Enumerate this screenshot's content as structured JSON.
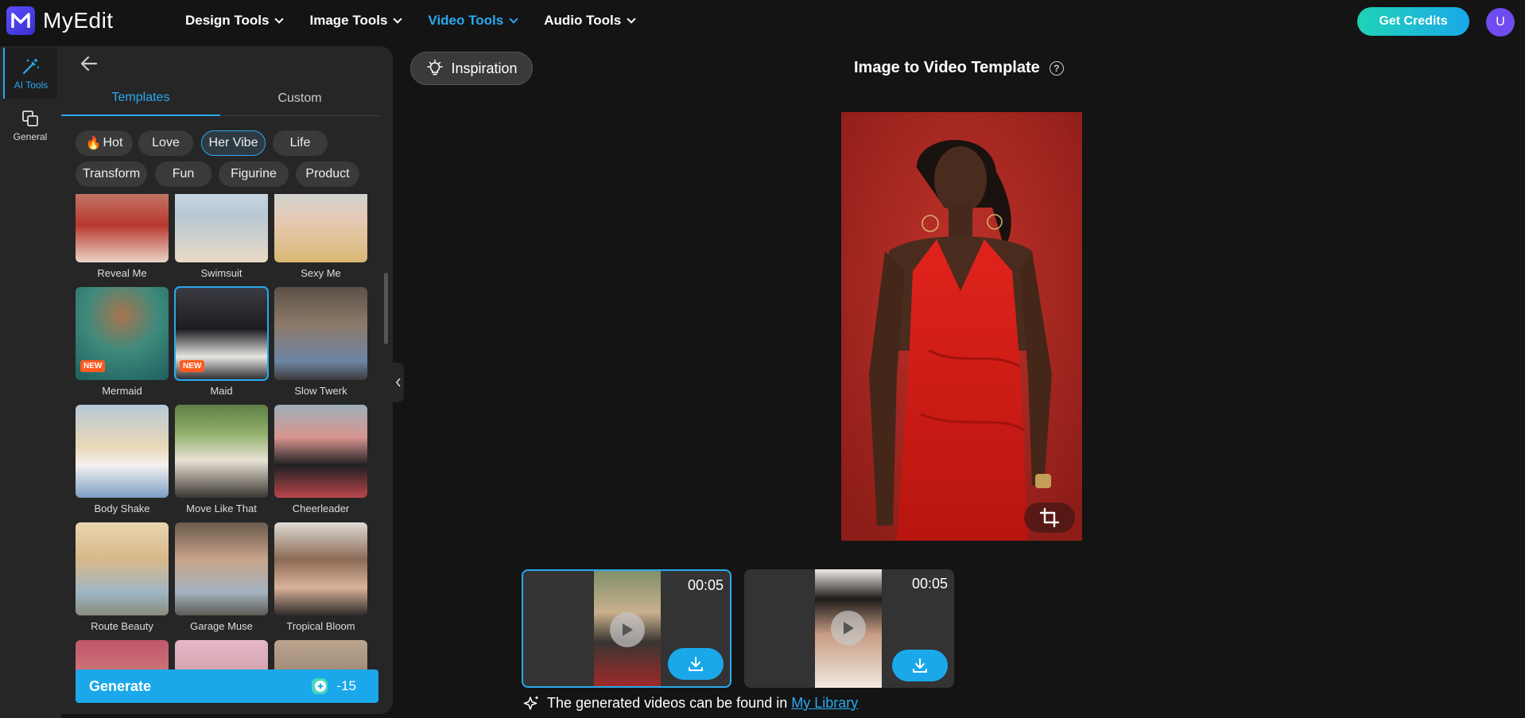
{
  "app": {
    "name": "MyEdit"
  },
  "nav": [
    {
      "label": "Design Tools",
      "active": false
    },
    {
      "label": "Image Tools",
      "active": false
    },
    {
      "label": "Video Tools",
      "active": true
    },
    {
      "label": "Audio Tools",
      "active": false
    }
  ],
  "header": {
    "credits_label": "Get Credits",
    "avatar_initial": "U"
  },
  "rail": {
    "ai_tools": "AI Tools",
    "general": "General"
  },
  "panel": {
    "tabs": [
      "Templates",
      "Custom"
    ],
    "active_tab": "Templates",
    "chips": [
      "Hot",
      "Love",
      "Her Vibe",
      "Life",
      "Transform",
      "Fun",
      "Figurine",
      "Product"
    ],
    "active_chip": "Her Vibe",
    "templates": [
      {
        "label": "Reveal Me",
        "new": false
      },
      {
        "label": "Swimsuit",
        "new": false
      },
      {
        "label": "Sexy Me",
        "new": false
      },
      {
        "label": "Mermaid",
        "new": true
      },
      {
        "label": "Maid",
        "new": true,
        "selected": true
      },
      {
        "label": "Slow Twerk",
        "new": false
      },
      {
        "label": "Body Shake",
        "new": false
      },
      {
        "label": "Move Like That",
        "new": false
      },
      {
        "label": "Cheerleader",
        "new": false
      },
      {
        "label": "Route Beauty",
        "new": false
      },
      {
        "label": "Garage Muse",
        "new": false
      },
      {
        "label": "Tropical Bloom",
        "new": false
      }
    ],
    "new_badge": "NEW",
    "generate_label": "Generate",
    "generate_cost": "-15"
  },
  "main": {
    "inspiration_label": "Inspiration",
    "title": "Image to Video Template",
    "help_glyph": "?",
    "results": [
      {
        "duration": "00:05",
        "selected": true
      },
      {
        "duration": "00:05",
        "selected": false
      }
    ],
    "note_text": "The generated videos can be found in",
    "note_link": "My Library"
  },
  "colors": {
    "accent": "#29a9f0",
    "bg": "#141414",
    "panel": "#262626",
    "new_badge": "#ff5a1f"
  }
}
